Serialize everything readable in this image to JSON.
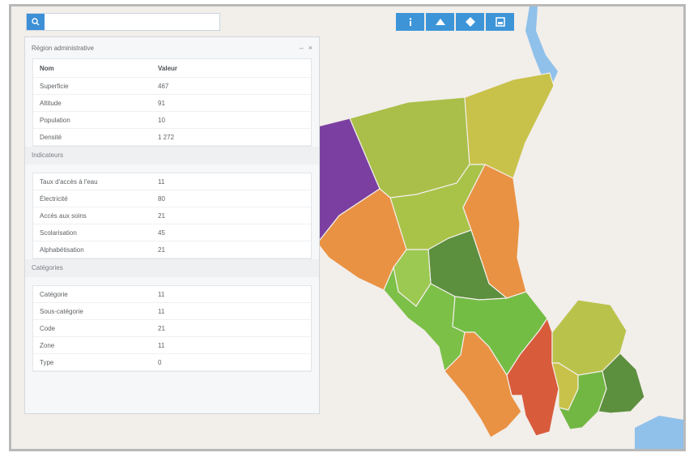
{
  "search": {
    "placeholder": ""
  },
  "toolbar": [
    {
      "icon": "info-icon"
    },
    {
      "icon": "layers-icon"
    },
    {
      "icon": "location-icon"
    },
    {
      "icon": "print-icon"
    }
  ],
  "panel": {
    "title": "Région administrative",
    "controls": {
      "minimize": "–",
      "close": "×"
    },
    "sections": [
      {
        "header": {
          "key": "Nom",
          "value": "Valeur"
        },
        "rows": [
          {
            "k": "Superficie",
            "v": "467"
          },
          {
            "k": "Altitude",
            "v": "91"
          },
          {
            "k": "Population",
            "v": "10"
          },
          {
            "k": "Densité",
            "v": "1 272"
          }
        ]
      },
      {
        "title": "Indicateurs",
        "rows": [
          {
            "k": "Taux d'accès à l'eau",
            "v": "11"
          },
          {
            "k": "Électricité",
            "v": "80"
          },
          {
            "k": "Accès aux soins",
            "v": "21"
          },
          {
            "k": "Scolarisation",
            "v": "45"
          },
          {
            "k": "Alphabétisation",
            "v": "21"
          }
        ]
      },
      {
        "title": "Catégories",
        "rows": [
          {
            "k": "Catégorie",
            "v": "11"
          },
          {
            "k": "Sous-catégorie",
            "v": "11"
          },
          {
            "k": "Code",
            "v": "21"
          },
          {
            "k": "Zone",
            "v": "11"
          },
          {
            "k": "Type",
            "v": "0"
          }
        ]
      }
    ]
  },
  "colors": {
    "purple": "#7b3fa1",
    "olive": "#a9bf49",
    "khaki": "#c9c24a",
    "orange": "#e99243",
    "green": "#7cc047",
    "darkgreen": "#5c8f3e",
    "red": "#d85b3b",
    "water": "#8fc1ea",
    "land": "#f2eeea"
  }
}
